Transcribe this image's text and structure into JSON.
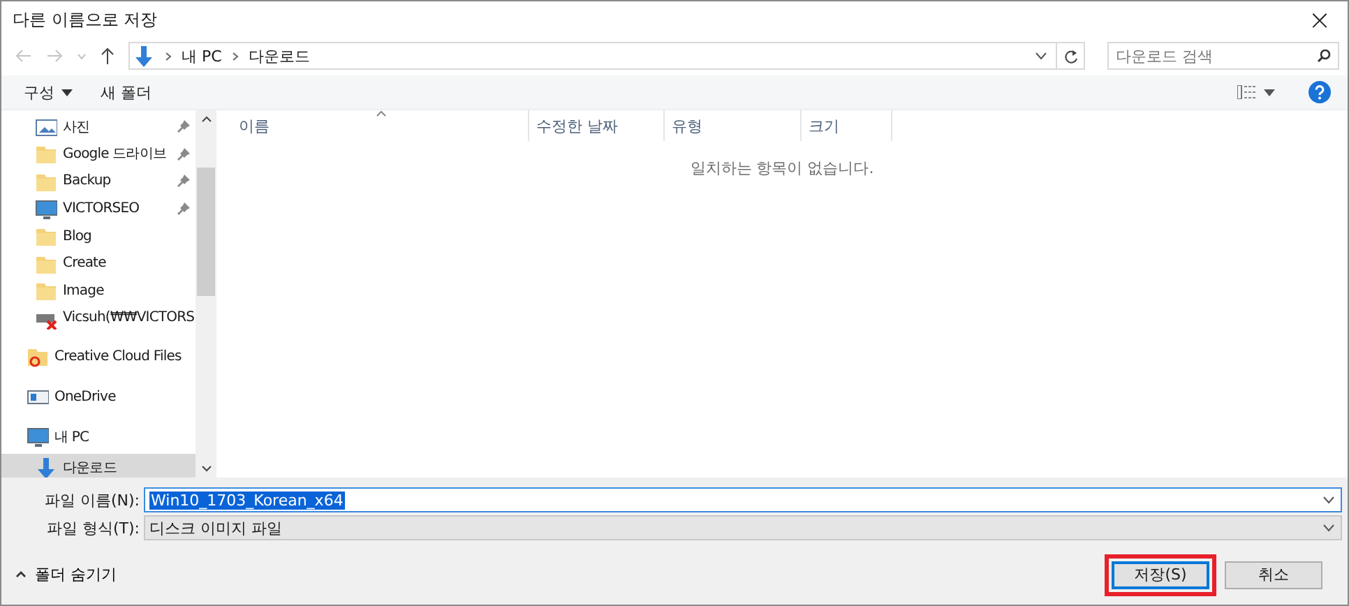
{
  "window": {
    "title": "다른 이름으로 저장",
    "close": "×"
  },
  "address": {
    "path": [
      "내 PC",
      "다운로드"
    ],
    "search_placeholder": "다운로드 검색"
  },
  "toolbar": {
    "organize": "구성",
    "new_folder": "새 폴더"
  },
  "sidebar": {
    "quick_access": [
      {
        "label": "사진",
        "kind": "pictures",
        "pinned": true,
        "selected": false
      },
      {
        "label": "Google 드라이브",
        "kind": "folder",
        "pinned": true,
        "selected": false
      },
      {
        "label": "Backup",
        "kind": "folder",
        "pinned": true,
        "selected": false
      },
      {
        "label": "VICTORSEO",
        "kind": "monitor",
        "pinned": true,
        "selected": false
      },
      {
        "label": "Blog",
        "kind": "folder",
        "pinned": false,
        "selected": false
      },
      {
        "label": "Create",
        "kind": "folder",
        "pinned": false,
        "selected": false
      },
      {
        "label": "Image",
        "kind": "folder",
        "pinned": false,
        "selected": false
      },
      {
        "label": "Vicsuh(₩₩VICTORS",
        "kind": "netdrive",
        "pinned": false,
        "selected": false
      }
    ],
    "roots": [
      {
        "label": "Creative Cloud Files",
        "kind": "ccfolder",
        "selected": false
      },
      {
        "label": "OneDrive",
        "kind": "onedrive",
        "selected": false
      },
      {
        "label": "내 PC",
        "kind": "monitor",
        "selected": false,
        "children": [
          {
            "label": "다운로드",
            "kind": "download",
            "selected": true
          }
        ]
      }
    ]
  },
  "table": {
    "columns": [
      "이름",
      "수정한 날짜",
      "유형",
      "크기"
    ],
    "empty_message": "일치하는 항목이 없습니다."
  },
  "form": {
    "filename_label": "파일 이름(N):",
    "filename": "Win10_1703_Korean_x64",
    "filetype_label": "파일 형식(T):",
    "filetype": "디스크 이미지 파일"
  },
  "footer": {
    "hide_folders": "폴더 숨기기",
    "buttons": [
      {
        "label": "저장(S)",
        "kind": "primary",
        "highlighted": true
      },
      {
        "label": "취소",
        "kind": "normal",
        "highlighted": false
      }
    ]
  }
}
